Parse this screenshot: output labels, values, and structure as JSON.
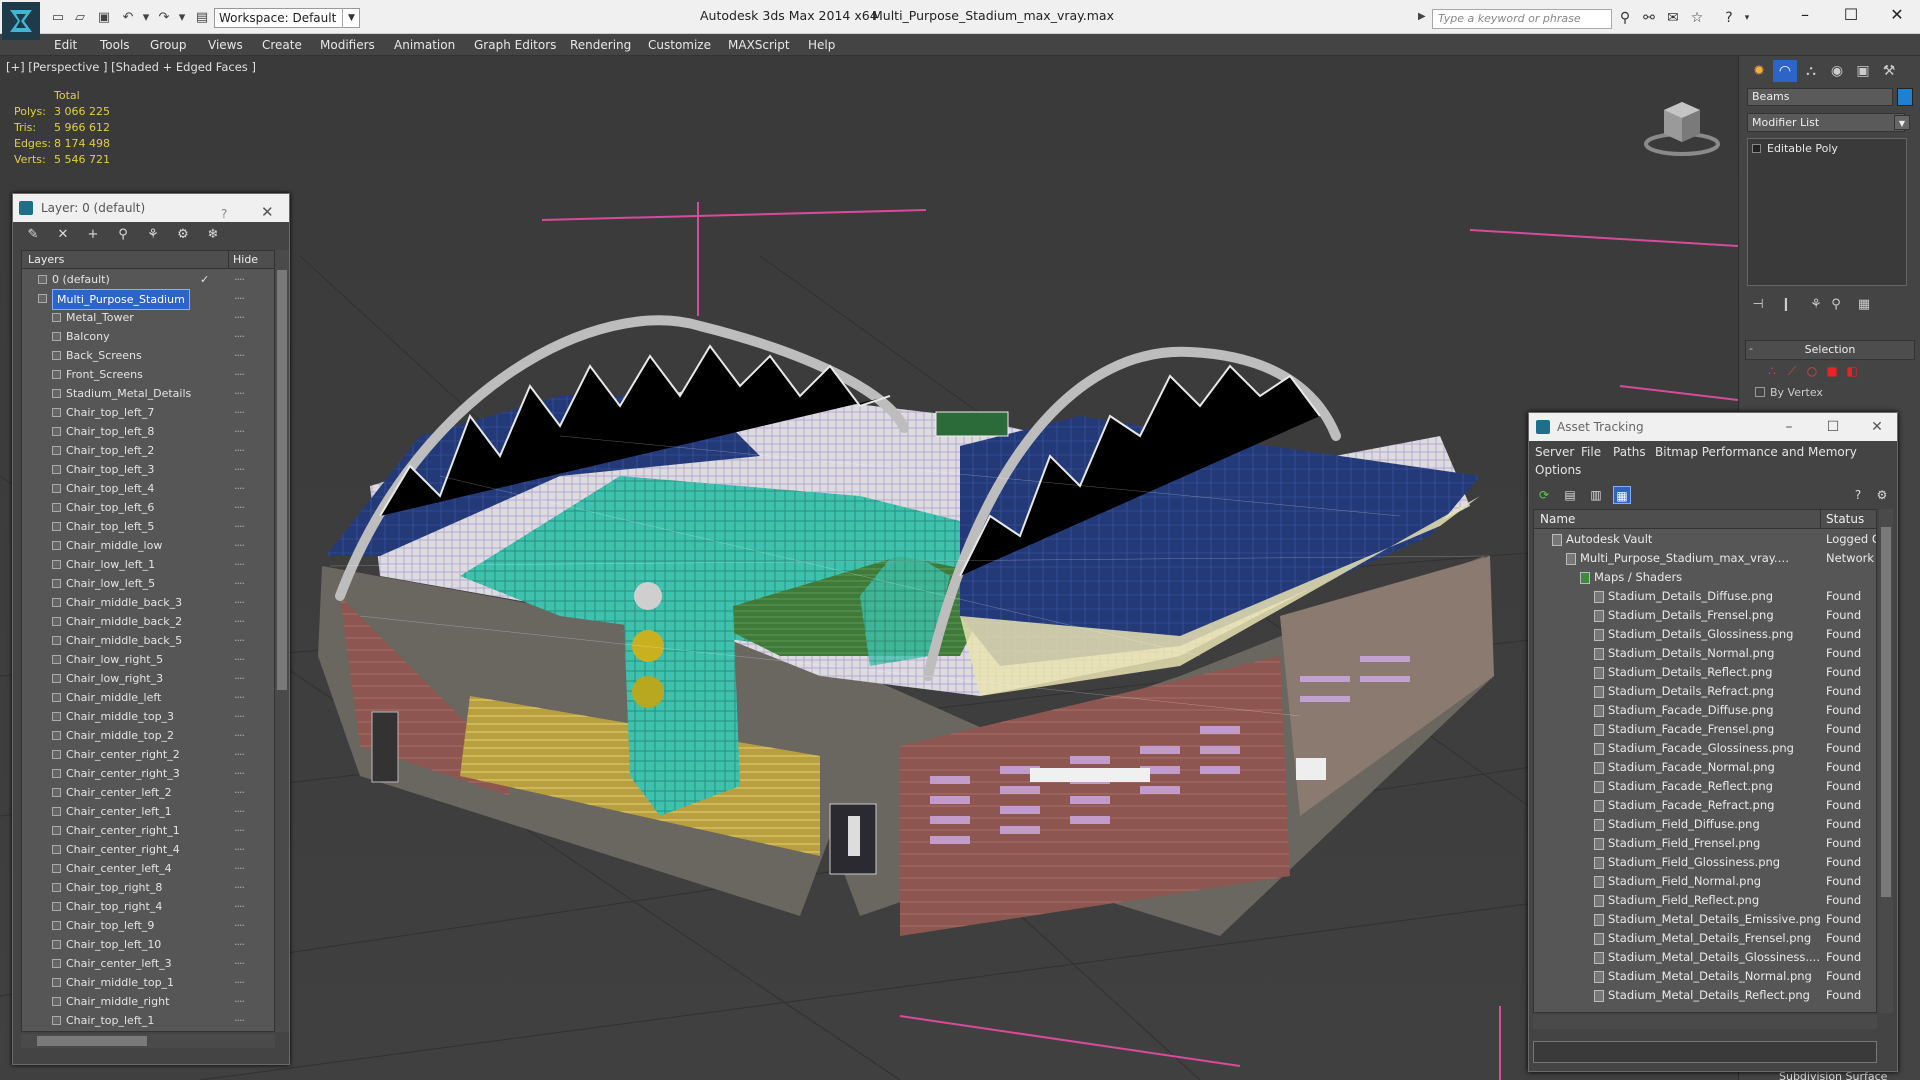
{
  "titlebar": {
    "app_title": "Autodesk 3ds Max  2014 x64",
    "file_title": "Multi_Purpose_Stadium_max_vray.max",
    "workspace": "Workspace: Default",
    "search_placeholder": "Type a keyword or phrase"
  },
  "menu": [
    "Edit",
    "Tools",
    "Group",
    "Views",
    "Create",
    "Modifiers",
    "Animation",
    "Graph Editors",
    "Rendering",
    "Customize",
    "MAXScript",
    "Help"
  ],
  "viewport": {
    "label": "[+] [Perspective ] [Shaded + Edged Faces ]",
    "stats": {
      "header": "Total",
      "rows": [
        {
          "label": "Polys:",
          "value": "3 066 225"
        },
        {
          "label": "Tris:",
          "value": "5 966 612"
        },
        {
          "label": "Edges:",
          "value": "8 174 498"
        },
        {
          "label": "Verts:",
          "value": "5 546 721"
        }
      ]
    }
  },
  "layer_window": {
    "title": "Layer: 0 (default)",
    "help": "?",
    "col_layers": "Layers",
    "col_hide": "Hide",
    "rows": [
      {
        "name": "0 (default)",
        "level": 0,
        "checked": true
      },
      {
        "name": "Multi_Purpose_Stadium",
        "level": 0,
        "selected": true
      },
      {
        "name": "Metal_Tower",
        "level": 1
      },
      {
        "name": "Balcony",
        "level": 1
      },
      {
        "name": "Back_Screens",
        "level": 1
      },
      {
        "name": "Front_Screens",
        "level": 1
      },
      {
        "name": "Stadium_Metal_Details",
        "level": 1
      },
      {
        "name": "Chair_top_left_7",
        "level": 1
      },
      {
        "name": "Chair_top_left_8",
        "level": 1
      },
      {
        "name": "Chair_top_left_2",
        "level": 1
      },
      {
        "name": "Chair_top_left_3",
        "level": 1
      },
      {
        "name": "Chair_top_left_4",
        "level": 1
      },
      {
        "name": "Chair_top_left_6",
        "level": 1
      },
      {
        "name": "Chair_top_left_5",
        "level": 1
      },
      {
        "name": "Chair_middle_low",
        "level": 1
      },
      {
        "name": "Chair_low_left_1",
        "level": 1
      },
      {
        "name": "Chair_low_left_5",
        "level": 1
      },
      {
        "name": "Chair_middle_back_3",
        "level": 1
      },
      {
        "name": "Chair_middle_back_2",
        "level": 1
      },
      {
        "name": "Chair_middle_back_5",
        "level": 1
      },
      {
        "name": "Chair_low_right_5",
        "level": 1
      },
      {
        "name": "Chair_low_right_3",
        "level": 1
      },
      {
        "name": "Chair_middle_left",
        "level": 1
      },
      {
        "name": "Chair_middle_top_3",
        "level": 1
      },
      {
        "name": "Chair_middle_top_2",
        "level": 1
      },
      {
        "name": "Chair_center_right_2",
        "level": 1
      },
      {
        "name": "Chair_center_right_3",
        "level": 1
      },
      {
        "name": "Chair_center_left_2",
        "level": 1
      },
      {
        "name": "Chair_center_left_1",
        "level": 1
      },
      {
        "name": "Chair_center_right_1",
        "level": 1
      },
      {
        "name": "Chair_center_right_4",
        "level": 1
      },
      {
        "name": "Chair_center_left_4",
        "level": 1
      },
      {
        "name": "Chair_top_right_8",
        "level": 1
      },
      {
        "name": "Chair_top_right_4",
        "level": 1
      },
      {
        "name": "Chair_top_left_9",
        "level": 1
      },
      {
        "name": "Chair_top_left_10",
        "level": 1
      },
      {
        "name": "Chair_center_left_3",
        "level": 1
      },
      {
        "name": "Chair_middle_top_1",
        "level": 1
      },
      {
        "name": "Chair_middle_right",
        "level": 1
      },
      {
        "name": "Chair_top_left_1",
        "level": 1
      }
    ]
  },
  "command_panel": {
    "object_name": "Beams",
    "object_color": "#1f7fd0",
    "modifier_list": "Modifier List",
    "stack_item": "Editable Poly",
    "selection_rollout": "Selection",
    "by_vertex": "By Vertex",
    "subdivision": "Subdivision Surface"
  },
  "asset_window": {
    "title": "Asset Tracking",
    "menu": [
      "Server",
      "File",
      "Paths",
      "Bitmap Performance and Memory",
      "Options"
    ],
    "col_name": "Name",
    "col_status": "Status",
    "rows": [
      {
        "name": "Autodesk Vault",
        "status": "Logged O",
        "level": 0
      },
      {
        "name": "Multi_Purpose_Stadium_max_vray.max",
        "status": "Network P",
        "level": 1
      },
      {
        "name": "Maps / Shaders",
        "status": "",
        "level": 2
      },
      {
        "name": "Stadium_Details_Diffuse.png",
        "status": "Found",
        "level": 3
      },
      {
        "name": "Stadium_Details_Frensel.png",
        "status": "Found",
        "level": 3
      },
      {
        "name": "Stadium_Details_Glossiness.png",
        "status": "Found",
        "level": 3
      },
      {
        "name": "Stadium_Details_Normal.png",
        "status": "Found",
        "level": 3
      },
      {
        "name": "Stadium_Details_Reflect.png",
        "status": "Found",
        "level": 3
      },
      {
        "name": "Stadium_Details_Refract.png",
        "status": "Found",
        "level": 3
      },
      {
        "name": "Stadium_Facade_Diffuse.png",
        "status": "Found",
        "level": 3
      },
      {
        "name": "Stadium_Facade_Frensel.png",
        "status": "Found",
        "level": 3
      },
      {
        "name": "Stadium_Facade_Glossiness.png",
        "status": "Found",
        "level": 3
      },
      {
        "name": "Stadium_Facade_Normal.png",
        "status": "Found",
        "level": 3
      },
      {
        "name": "Stadium_Facade_Reflect.png",
        "status": "Found",
        "level": 3
      },
      {
        "name": "Stadium_Facade_Refract.png",
        "status": "Found",
        "level": 3
      },
      {
        "name": "Stadium_Field_Diffuse.png",
        "status": "Found",
        "level": 3
      },
      {
        "name": "Stadium_Field_Frensel.png",
        "status": "Found",
        "level": 3
      },
      {
        "name": "Stadium_Field_Glossiness.png",
        "status": "Found",
        "level": 3
      },
      {
        "name": "Stadium_Field_Normal.png",
        "status": "Found",
        "level": 3
      },
      {
        "name": "Stadium_Field_Reflect.png",
        "status": "Found",
        "level": 3
      },
      {
        "name": "Stadium_Metal_Details_Emissive.png",
        "status": "Found",
        "level": 3
      },
      {
        "name": "Stadium_Metal_Details_Frensel.png",
        "status": "Found",
        "level": 3
      },
      {
        "name": "Stadium_Metal_Details_Glossiness....",
        "status": "Found",
        "level": 3
      },
      {
        "name": "Stadium_Metal_Details_Normal.png",
        "status": "Found",
        "level": 3
      },
      {
        "name": "Stadium_Metal_Details_Reflect.png",
        "status": "Found",
        "level": 3
      }
    ]
  }
}
